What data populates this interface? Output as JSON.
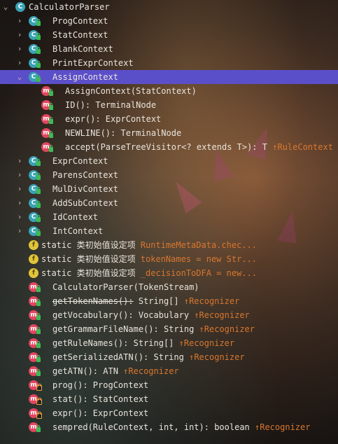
{
  "root": {
    "name": "CalculatorParser",
    "expanded": true,
    "icon": "class-icon"
  },
  "children": [
    {
      "kind": "class",
      "expandable": true,
      "expanded": false,
      "name": "ProgContext",
      "suffix": "",
      "hint": ""
    },
    {
      "kind": "class",
      "expandable": true,
      "expanded": false,
      "name": "StatContext",
      "suffix": "",
      "hint": ""
    },
    {
      "kind": "class",
      "expandable": true,
      "expanded": false,
      "name": "BlankContext",
      "suffix": "",
      "hint": ""
    },
    {
      "kind": "class",
      "expandable": true,
      "expanded": false,
      "name": "PrintExprContext",
      "suffix": "",
      "hint": ""
    },
    {
      "kind": "class",
      "expandable": true,
      "expanded": true,
      "selected": true,
      "name": "AssignContext",
      "suffix": "",
      "hint": "",
      "members": [
        {
          "kind": "method",
          "name": "AssignContext(StatContext)",
          "suffix": "",
          "hint": ""
        },
        {
          "kind": "method",
          "name": "ID():",
          "suffix": " TerminalNode",
          "hint": ""
        },
        {
          "kind": "method",
          "name": "expr():",
          "suffix": " ExprContext",
          "hint": ""
        },
        {
          "kind": "method",
          "name": "NEWLINE():",
          "suffix": " TerminalNode",
          "hint": ""
        },
        {
          "kind": "method",
          "name": "accept(ParseTreeVisitor<? extends T>):",
          "suffix": " T",
          "hint": "↑RuleContext"
        }
      ]
    },
    {
      "kind": "class",
      "expandable": true,
      "expanded": false,
      "name": "ExprContext",
      "suffix": "",
      "hint": ""
    },
    {
      "kind": "class",
      "expandable": true,
      "expanded": false,
      "name": "ParensContext",
      "suffix": "",
      "hint": ""
    },
    {
      "kind": "class",
      "expandable": true,
      "expanded": false,
      "name": "MulDivContext",
      "suffix": "",
      "hint": ""
    },
    {
      "kind": "class",
      "expandable": true,
      "expanded": false,
      "name": "AddSubContext",
      "suffix": "",
      "hint": ""
    },
    {
      "kind": "class",
      "expandable": true,
      "expanded": false,
      "name": "IdContext",
      "suffix": "",
      "hint": ""
    },
    {
      "kind": "class",
      "expandable": true,
      "expanded": false,
      "name": "IntContext",
      "suffix": "",
      "hint": ""
    },
    {
      "kind": "field",
      "name": "static 类初始值设定项",
      "suffix": "",
      "hint": " RuntimeMetaData.chec..."
    },
    {
      "kind": "field",
      "name": "static 类初始值设定项",
      "suffix": "",
      "hint": " tokenNames = new Str..."
    },
    {
      "kind": "field",
      "name": "static 类初始值设定项",
      "suffix": "",
      "hint": " _decisionToDFA = new..."
    },
    {
      "kind": "method",
      "name": "CalculatorParser(TokenStream)",
      "suffix": "",
      "hint": ""
    },
    {
      "kind": "method",
      "name": "getTokenNames():",
      "suffix": " String[]",
      "hint": " ↑Recognizer",
      "strike": true
    },
    {
      "kind": "method",
      "name": "getVocabulary():",
      "suffix": " Vocabulary",
      "hint": " ↑Recognizer"
    },
    {
      "kind": "method",
      "name": "getGrammarFileName():",
      "suffix": " String",
      "hint": " ↑Recognizer"
    },
    {
      "kind": "method",
      "name": "getRuleNames():",
      "suffix": " String[]",
      "hint": " ↑Recognizer"
    },
    {
      "kind": "method",
      "name": "getSerializedATN():",
      "suffix": " String",
      "hint": " ↑Recognizer"
    },
    {
      "kind": "method",
      "name": "getATN():",
      "suffix": " ATN",
      "hint": " ↑Recognizer"
    },
    {
      "kind": "method",
      "vis": "protected",
      "name": "prog():",
      "suffix": " ProgContext",
      "hint": ""
    },
    {
      "kind": "method",
      "vis": "protected",
      "name": "stat():",
      "suffix": " StatContext",
      "hint": ""
    },
    {
      "kind": "method",
      "vis": "protected",
      "name": "expr():",
      "suffix": " ExprContext",
      "hint": ""
    },
    {
      "kind": "method",
      "name": "sempred(RuleContext, int, int):",
      "suffix": " boolean",
      "hint": " ↑Recognizer"
    }
  ]
}
